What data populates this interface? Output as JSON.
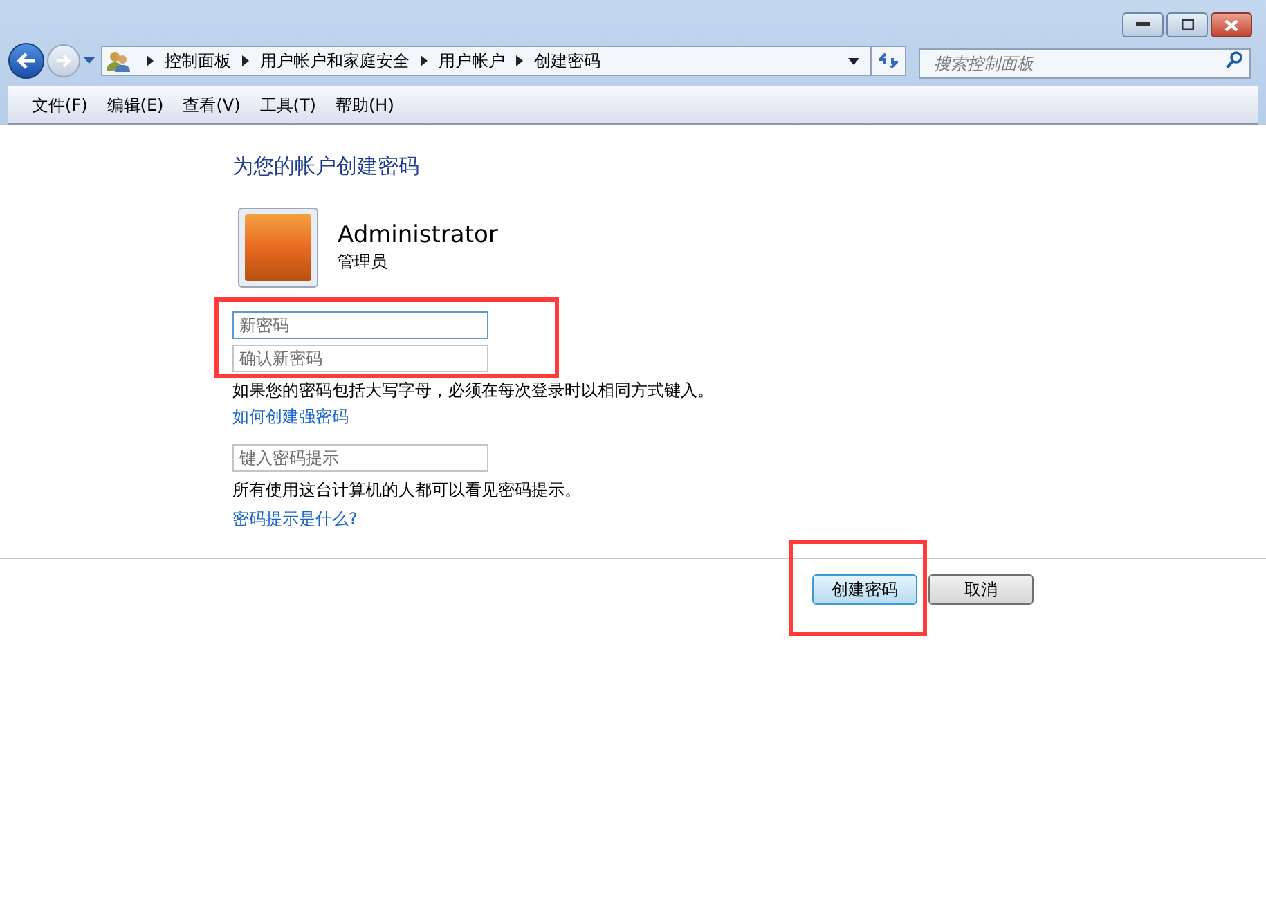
{
  "address_bar": {
    "breadcrumbs": [
      "控制面板",
      "用户帐户和家庭安全",
      "用户帐户",
      "创建密码"
    ]
  },
  "search": {
    "placeholder": "搜索控制面板"
  },
  "menu": [
    "文件(F)",
    "编辑(E)",
    "查看(V)",
    "工具(T)",
    "帮助(H)"
  ],
  "heading": "为您的帐户创建密码",
  "account": {
    "name": "Administrator",
    "role": "管理员"
  },
  "password_fields": [
    {
      "placeholder": "新密码",
      "focused": true
    },
    {
      "placeholder": "确认新密码",
      "focused": false
    }
  ],
  "caps_note": "如果您的密码包括大写字母，必须在每次登录时以相同方式键入。",
  "strong_link": "如何创建强密码",
  "hint_field": {
    "placeholder": "键入密码提示"
  },
  "hint_note": "所有使用这台计算机的人都可以看见密码提示。",
  "hint_link": "密码提示是什么?",
  "buttons": [
    {
      "label": "创建密码",
      "default": true
    },
    {
      "label": "取消",
      "default": false
    }
  ]
}
